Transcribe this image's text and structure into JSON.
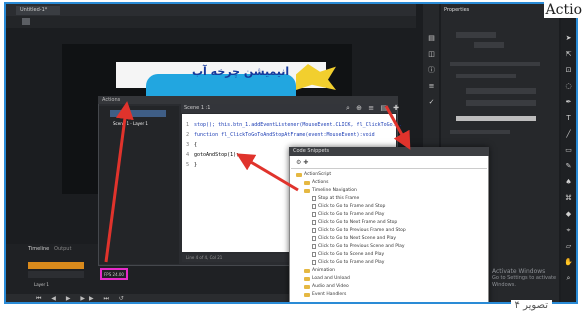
{
  "corner_label": "Actio",
  "caption": "تصویر ۴",
  "app": {
    "document_tab": "Untitled-1*",
    "stage_banner_text": "انیمیشن چرخه آب"
  },
  "actions_panel": {
    "header": "Actions",
    "tree_item": "Scene 1 - Layer 1",
    "script_tab": "Scene 1 :1",
    "code_lines": [
      "stop(); this.btn_1.addEventListener(MouseEvent.CLICK, fl_ClickToGo...",
      "function fl_ClickToGoToAndStopAtFrame(event:MouseEvent):void",
      "{",
      "  gotoAndStop(1);",
      "}"
    ],
    "status": "Line 4 of 4, Col 21"
  },
  "timeline": {
    "tabs": [
      "Timeline",
      "Output"
    ],
    "layers": [
      "Actions",
      "Layer 1"
    ],
    "frame_label": "FPS 24.00"
  },
  "code_snippets": {
    "title": "Code Snippets",
    "items": [
      {
        "kind": "folder",
        "text": "ActionScript",
        "indent": 0
      },
      {
        "kind": "folder",
        "text": "Actions",
        "indent": 1
      },
      {
        "kind": "folder",
        "text": "Timeline Navigation",
        "indent": 1
      },
      {
        "kind": "doc",
        "text": "Stop at this Frame",
        "indent": 2
      },
      {
        "kind": "doc",
        "text": "Click to Go to Frame and Stop",
        "indent": 2
      },
      {
        "kind": "doc",
        "text": "Click to Go to Frame and Play",
        "indent": 2
      },
      {
        "kind": "doc",
        "text": "Click to Go to Next Frame and Stop",
        "indent": 2
      },
      {
        "kind": "doc",
        "text": "Click to Go to Previous Frame and Stop",
        "indent": 2
      },
      {
        "kind": "doc",
        "text": "Click to Go to Next Scene and Play",
        "indent": 2
      },
      {
        "kind": "doc",
        "text": "Click to Go to Previous Scene and Play",
        "indent": 2
      },
      {
        "kind": "doc",
        "text": "Click to Go to Scene and Play",
        "indent": 2
      },
      {
        "kind": "doc",
        "text": "Click to Go to Frame and Play",
        "indent": 2
      },
      {
        "kind": "folder",
        "text": "Animation",
        "indent": 1
      },
      {
        "kind": "folder",
        "text": "Load and Unload",
        "indent": 1
      },
      {
        "kind": "folder",
        "text": "Audio and Video",
        "indent": 1
      },
      {
        "kind": "folder",
        "text": "Event Handlers",
        "indent": 1
      }
    ]
  },
  "watermark": [
    "Activate Windows",
    "Go to Settings to activate Windows."
  ],
  "properties": {
    "tab": "Properties"
  },
  "colors": {
    "frame_border": "#2a8bd6",
    "arrow": "#e0332c",
    "highlight_box": "#e62bc9"
  },
  "icons": [
    "play-icon",
    "stop-icon",
    "brush-icon",
    "pencil-icon",
    "eraser-icon",
    "eyedropper-icon",
    "hand-icon",
    "zoom-icon"
  ]
}
